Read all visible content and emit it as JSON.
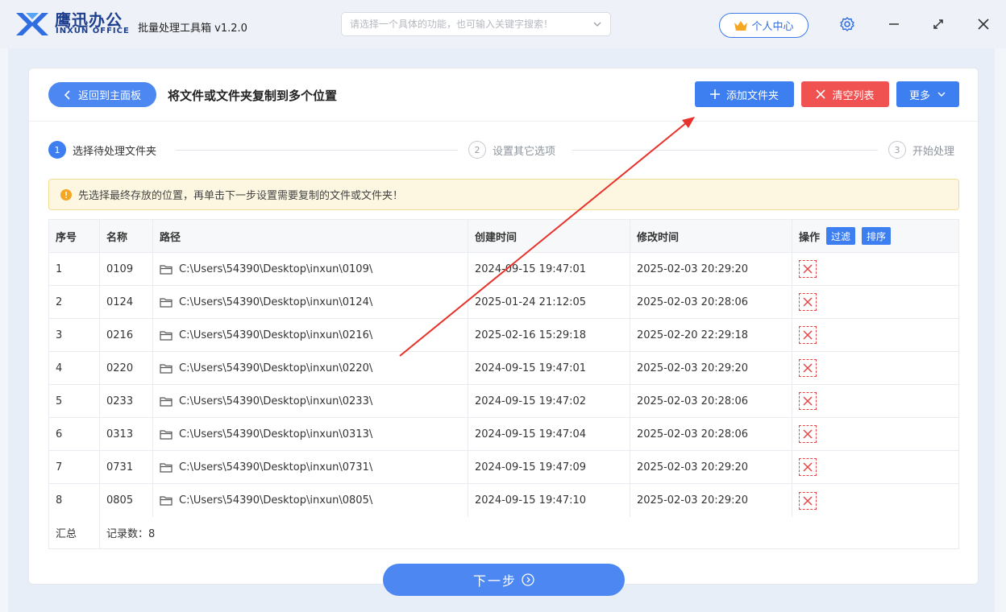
{
  "app": {
    "brand_cn": "鹰迅办公",
    "brand_en": "INXUN OFFICE",
    "title": "批量处理工具箱 v1.2.0",
    "search_placeholder": "请选择一个具体的功能，也可输入关键字搜索！",
    "user_center": "个人中心"
  },
  "header": {
    "back_label": "返回到主面板",
    "page_title": "将文件或文件夹复制到多个位置",
    "add_folder": "添加文件夹",
    "clear_list": "清空列表",
    "more": "更多"
  },
  "steps": [
    {
      "num": "1",
      "label": "选择待处理文件夹"
    },
    {
      "num": "2",
      "label": "设置其它选项"
    },
    {
      "num": "3",
      "label": "开始处理"
    }
  ],
  "notice": "先选择最终存放的位置，再单击下一步设置需要复制的文件或文件夹！",
  "table": {
    "headers": [
      "序号",
      "名称",
      "路径",
      "创建时间",
      "修改时间",
      "操作"
    ],
    "filter": "过滤",
    "sort": "排序",
    "rows": [
      {
        "idx": "1",
        "name": "0109",
        "path": "C:\\Users\\54390\\Desktop\\inxun\\0109\\",
        "created": "2024-09-15 19:47:01",
        "modified": "2025-02-03 20:29:20"
      },
      {
        "idx": "2",
        "name": "0124",
        "path": "C:\\Users\\54390\\Desktop\\inxun\\0124\\",
        "created": "2025-01-24 21:12:05",
        "modified": "2025-02-03 20:28:06"
      },
      {
        "idx": "3",
        "name": "0216",
        "path": "C:\\Users\\54390\\Desktop\\inxun\\0216\\",
        "created": "2025-02-16 15:29:18",
        "modified": "2025-02-20 22:29:18"
      },
      {
        "idx": "4",
        "name": "0220",
        "path": "C:\\Users\\54390\\Desktop\\inxun\\0220\\",
        "created": "2024-09-15 19:47:01",
        "modified": "2025-02-03 20:29:20"
      },
      {
        "idx": "5",
        "name": "0233",
        "path": "C:\\Users\\54390\\Desktop\\inxun\\0233\\",
        "created": "2024-09-15 19:47:02",
        "modified": "2025-02-03 20:28:06"
      },
      {
        "idx": "6",
        "name": "0313",
        "path": "C:\\Users\\54390\\Desktop\\inxun\\0313\\",
        "created": "2024-09-15 19:47:04",
        "modified": "2025-02-03 20:28:06"
      },
      {
        "idx": "7",
        "name": "0731",
        "path": "C:\\Users\\54390\\Desktop\\inxun\\0731\\",
        "created": "2024-09-15 19:47:09",
        "modified": "2025-02-03 20:29:20"
      },
      {
        "idx": "8",
        "name": "0805",
        "path": "C:\\Users\\54390\\Desktop\\inxun\\0805\\",
        "created": "2024-09-15 19:47:10",
        "modified": "2025-02-03 20:29:20"
      }
    ],
    "summary_label": "汇总",
    "record_count": "记录数：8"
  },
  "next_step": "下一步",
  "colors": {
    "accent": "#3d7ef0",
    "danger": "#f05252",
    "arrow": "#e8312a"
  },
  "icons": [
    "logo-icon",
    "chevron-down-icon",
    "crown-icon",
    "gear-icon",
    "minimize-icon",
    "maximize-icon",
    "close-icon",
    "chevron-left-icon",
    "plus-icon",
    "x-icon",
    "info-icon",
    "folder-icon",
    "delete-icon",
    "arrow-right-circle-icon"
  ]
}
